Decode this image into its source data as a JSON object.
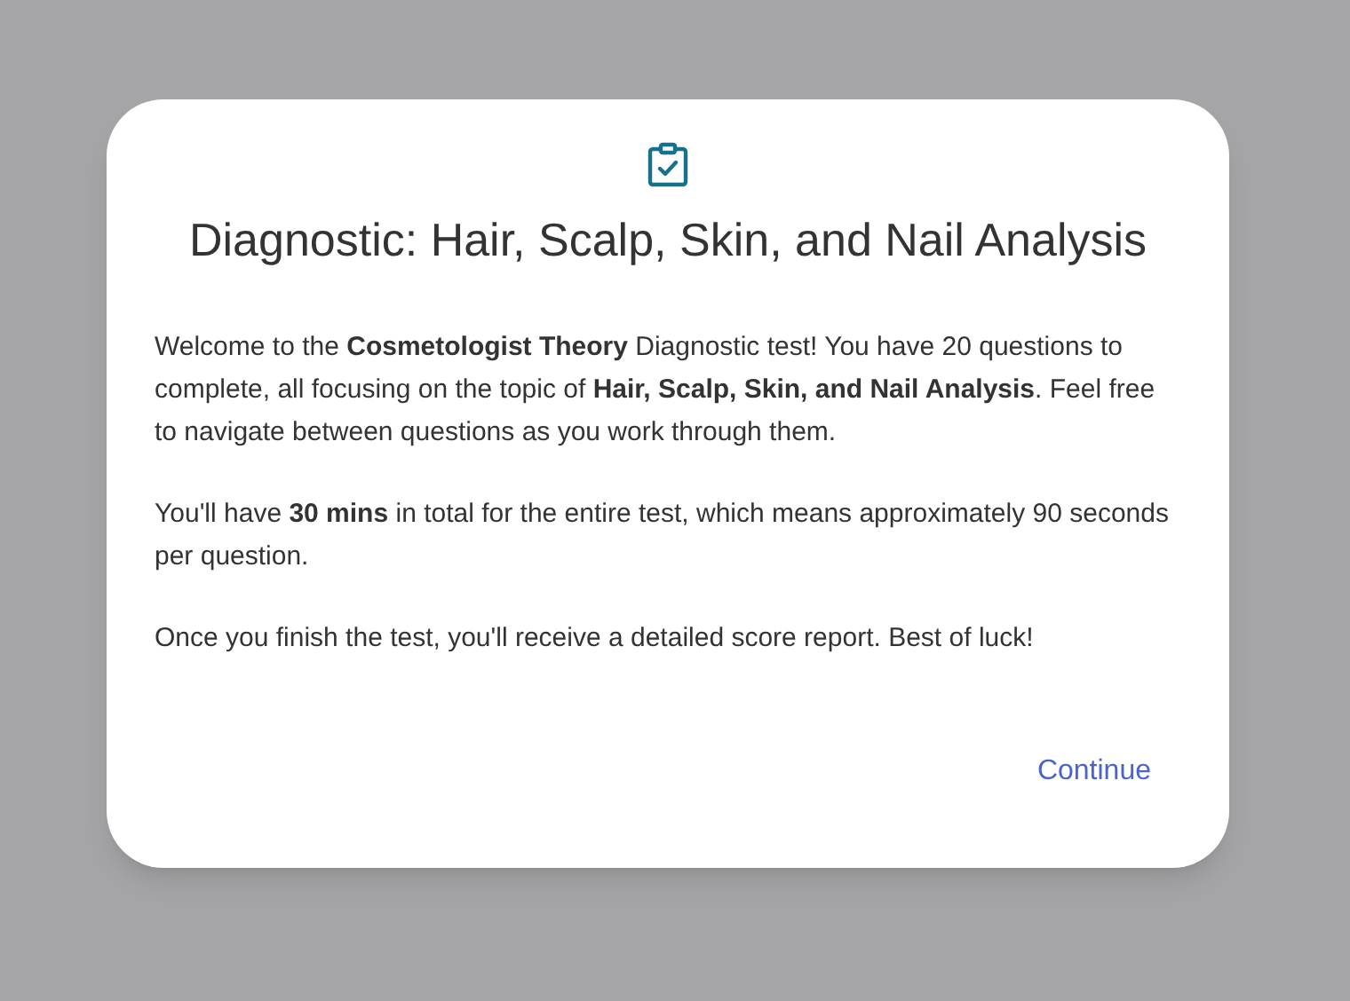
{
  "dialog": {
    "title": "Diagnostic: Hair, Scalp, Skin, and Nail Analysis",
    "paragraphs": [
      "Welcome to the **Cosmetologist Theory** Diagnostic test! You have 20 questions to complete, all focusing on the topic of **Hair, Scalp, Skin, and Nail Analysis**. Feel free to navigate between questions as you work through them.",
      "You'll have **30 mins** in total for the entire test, which means approximately 90 seconds per question.",
      "Once you finish the test, you'll receive a detailed score report. Best of luck!"
    ],
    "buttons": [
      "Continue"
    ]
  }
}
